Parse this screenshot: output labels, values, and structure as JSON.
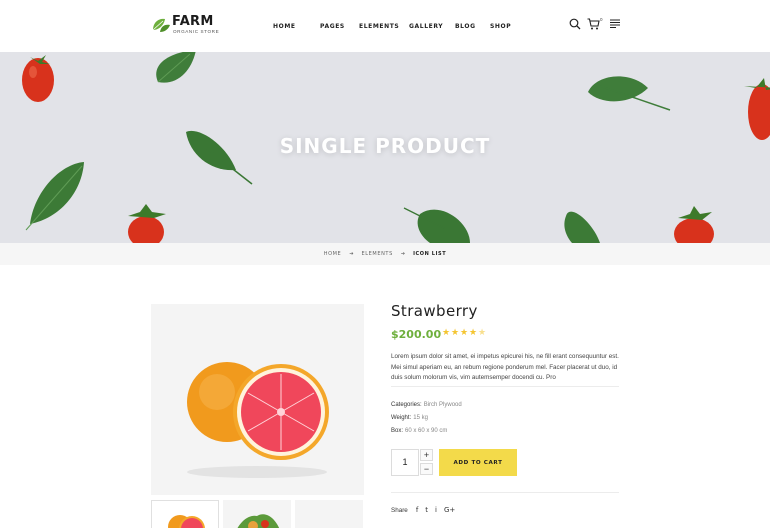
{
  "header": {
    "logo_title": "FARM",
    "logo_subtitle": "ORGANIC STORE",
    "nav": [
      "HOME",
      "PAGES",
      "ELEMENTS",
      "GALLERY",
      "BLOG",
      "SHOP"
    ],
    "cart_count": "0",
    "icons": [
      "search-icon",
      "cart-icon",
      "menu-icon"
    ]
  },
  "banner": {
    "title": "SINGLE PRODUCT"
  },
  "breadcrumb": {
    "items": [
      "HOME",
      "ELEMENTS",
      "ICON LIST"
    ]
  },
  "product": {
    "name": "Strawberry",
    "price": "$200.00",
    "rating": 4.5,
    "rating_max": 5,
    "description": "Lorem ipsum dolor sit amet, ei impetus epicurei his, ne fill erant consequuntur est. Mei simul aperiam eu, an rebum regione ponderum mel. Facer placerat ut duo, id duis solum molorum vis, vim autemsemper docendi cu. Pro",
    "categories_label": "Categories:",
    "categories_value": "Birch Plywood",
    "weight_label": "Weight:",
    "weight_value": "15 kg",
    "box_label": "Box:",
    "box_value": "60 x 60 x 90 cm",
    "quantity": "1",
    "plus": "+",
    "minus": "−",
    "add_to_cart": "ADD TO CART",
    "share_label": "Share",
    "social": [
      "f",
      "t",
      "i",
      "G+"
    ]
  },
  "colors": {
    "accent_green": "#6eaf3d",
    "button_yellow": "#f3da4a",
    "star": "#f4c531",
    "banner_bg": "#e2e3e8"
  }
}
